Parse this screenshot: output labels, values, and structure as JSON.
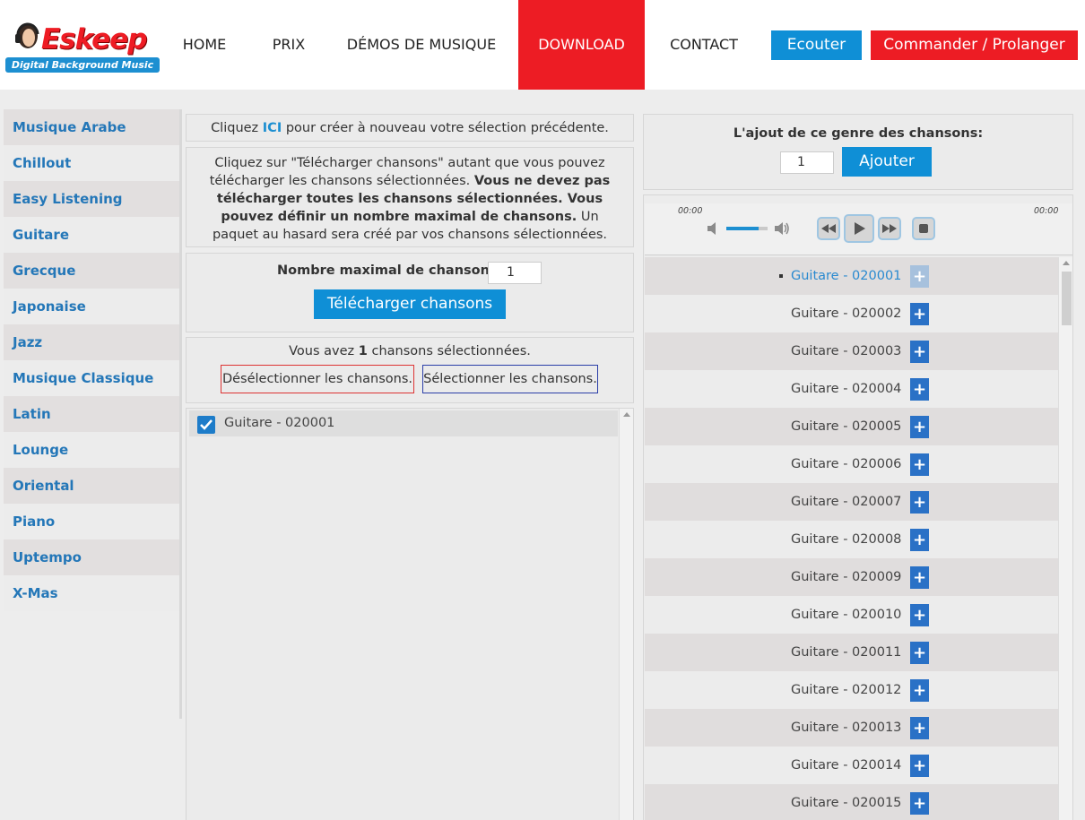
{
  "brand": {
    "logo_text": "Eskeep",
    "tagline": "Digital Background Music"
  },
  "nav": {
    "items": [
      {
        "label": "HOME"
      },
      {
        "label": "PRIX"
      },
      {
        "label": "DÉMOS DE MUSIQUE"
      },
      {
        "label": "DOWNLOAD",
        "active": true
      },
      {
        "label": "CONTACT"
      }
    ],
    "ecouter": "Ecouter",
    "commander": "Commander / Prolanger"
  },
  "colors": {
    "accent_blue": "#0f8fd6",
    "accent_red": "#ed1c24",
    "link_blue": "#2477b8"
  },
  "sidebar": {
    "items": [
      "Musique Arabe",
      "Chillout",
      "Easy Listening",
      "Guitare",
      "Grecque",
      "Japonaise",
      "Jazz",
      "Musique Classique",
      "Latin",
      "Lounge",
      "Oriental",
      "Piano",
      "Uptempo",
      "X-Mas"
    ]
  },
  "middle": {
    "recreate": {
      "prefix": "Cliquez ",
      "link": "ICI",
      "suffix": " pour créer à nouveau votre sélection précédente."
    },
    "info": {
      "part1": "Cliquez sur \"Télécharger chansons\" autant que vous pouvez télécharger les chansons sélectionnées. ",
      "bold": "Vous ne devez pas télécharger toutes les chansons sélectionnées. Vous pouvez définir un nombre maximal de chansons.",
      "part2": " Un paquet au hasard sera créé par vos chansons sélectionnées."
    },
    "max_label": "Nombre maximal de chansons:",
    "max_value": "1",
    "download_button": "Télécharger chansons",
    "selected": {
      "prefix": "Vous avez ",
      "count": "1",
      "suffix": " chansons sélectionnées."
    },
    "deselect_button": "Désélectionner les chansons.",
    "select_button": "Sélectionner les chansons.",
    "selected_list": [
      {
        "label": "Guitare - 020001",
        "checked": true
      }
    ]
  },
  "right": {
    "add_label": "L'ajout de ce genre des chansons:",
    "add_value": "1",
    "add_button": "Ajouter",
    "player": {
      "time_current": "00:00",
      "time_total": "00:00",
      "volume": 0.78
    },
    "songs": [
      {
        "label": "Guitare - 020001",
        "selected": true
      },
      {
        "label": "Guitare - 020002"
      },
      {
        "label": "Guitare - 020003"
      },
      {
        "label": "Guitare - 020004"
      },
      {
        "label": "Guitare - 020005"
      },
      {
        "label": "Guitare - 020006"
      },
      {
        "label": "Guitare - 020007"
      },
      {
        "label": "Guitare - 020008"
      },
      {
        "label": "Guitare - 020009"
      },
      {
        "label": "Guitare - 020010"
      },
      {
        "label": "Guitare - 020011"
      },
      {
        "label": "Guitare - 020012"
      },
      {
        "label": "Guitare - 020013"
      },
      {
        "label": "Guitare - 020014"
      },
      {
        "label": "Guitare - 020015"
      }
    ],
    "plus_glyph": "+"
  }
}
